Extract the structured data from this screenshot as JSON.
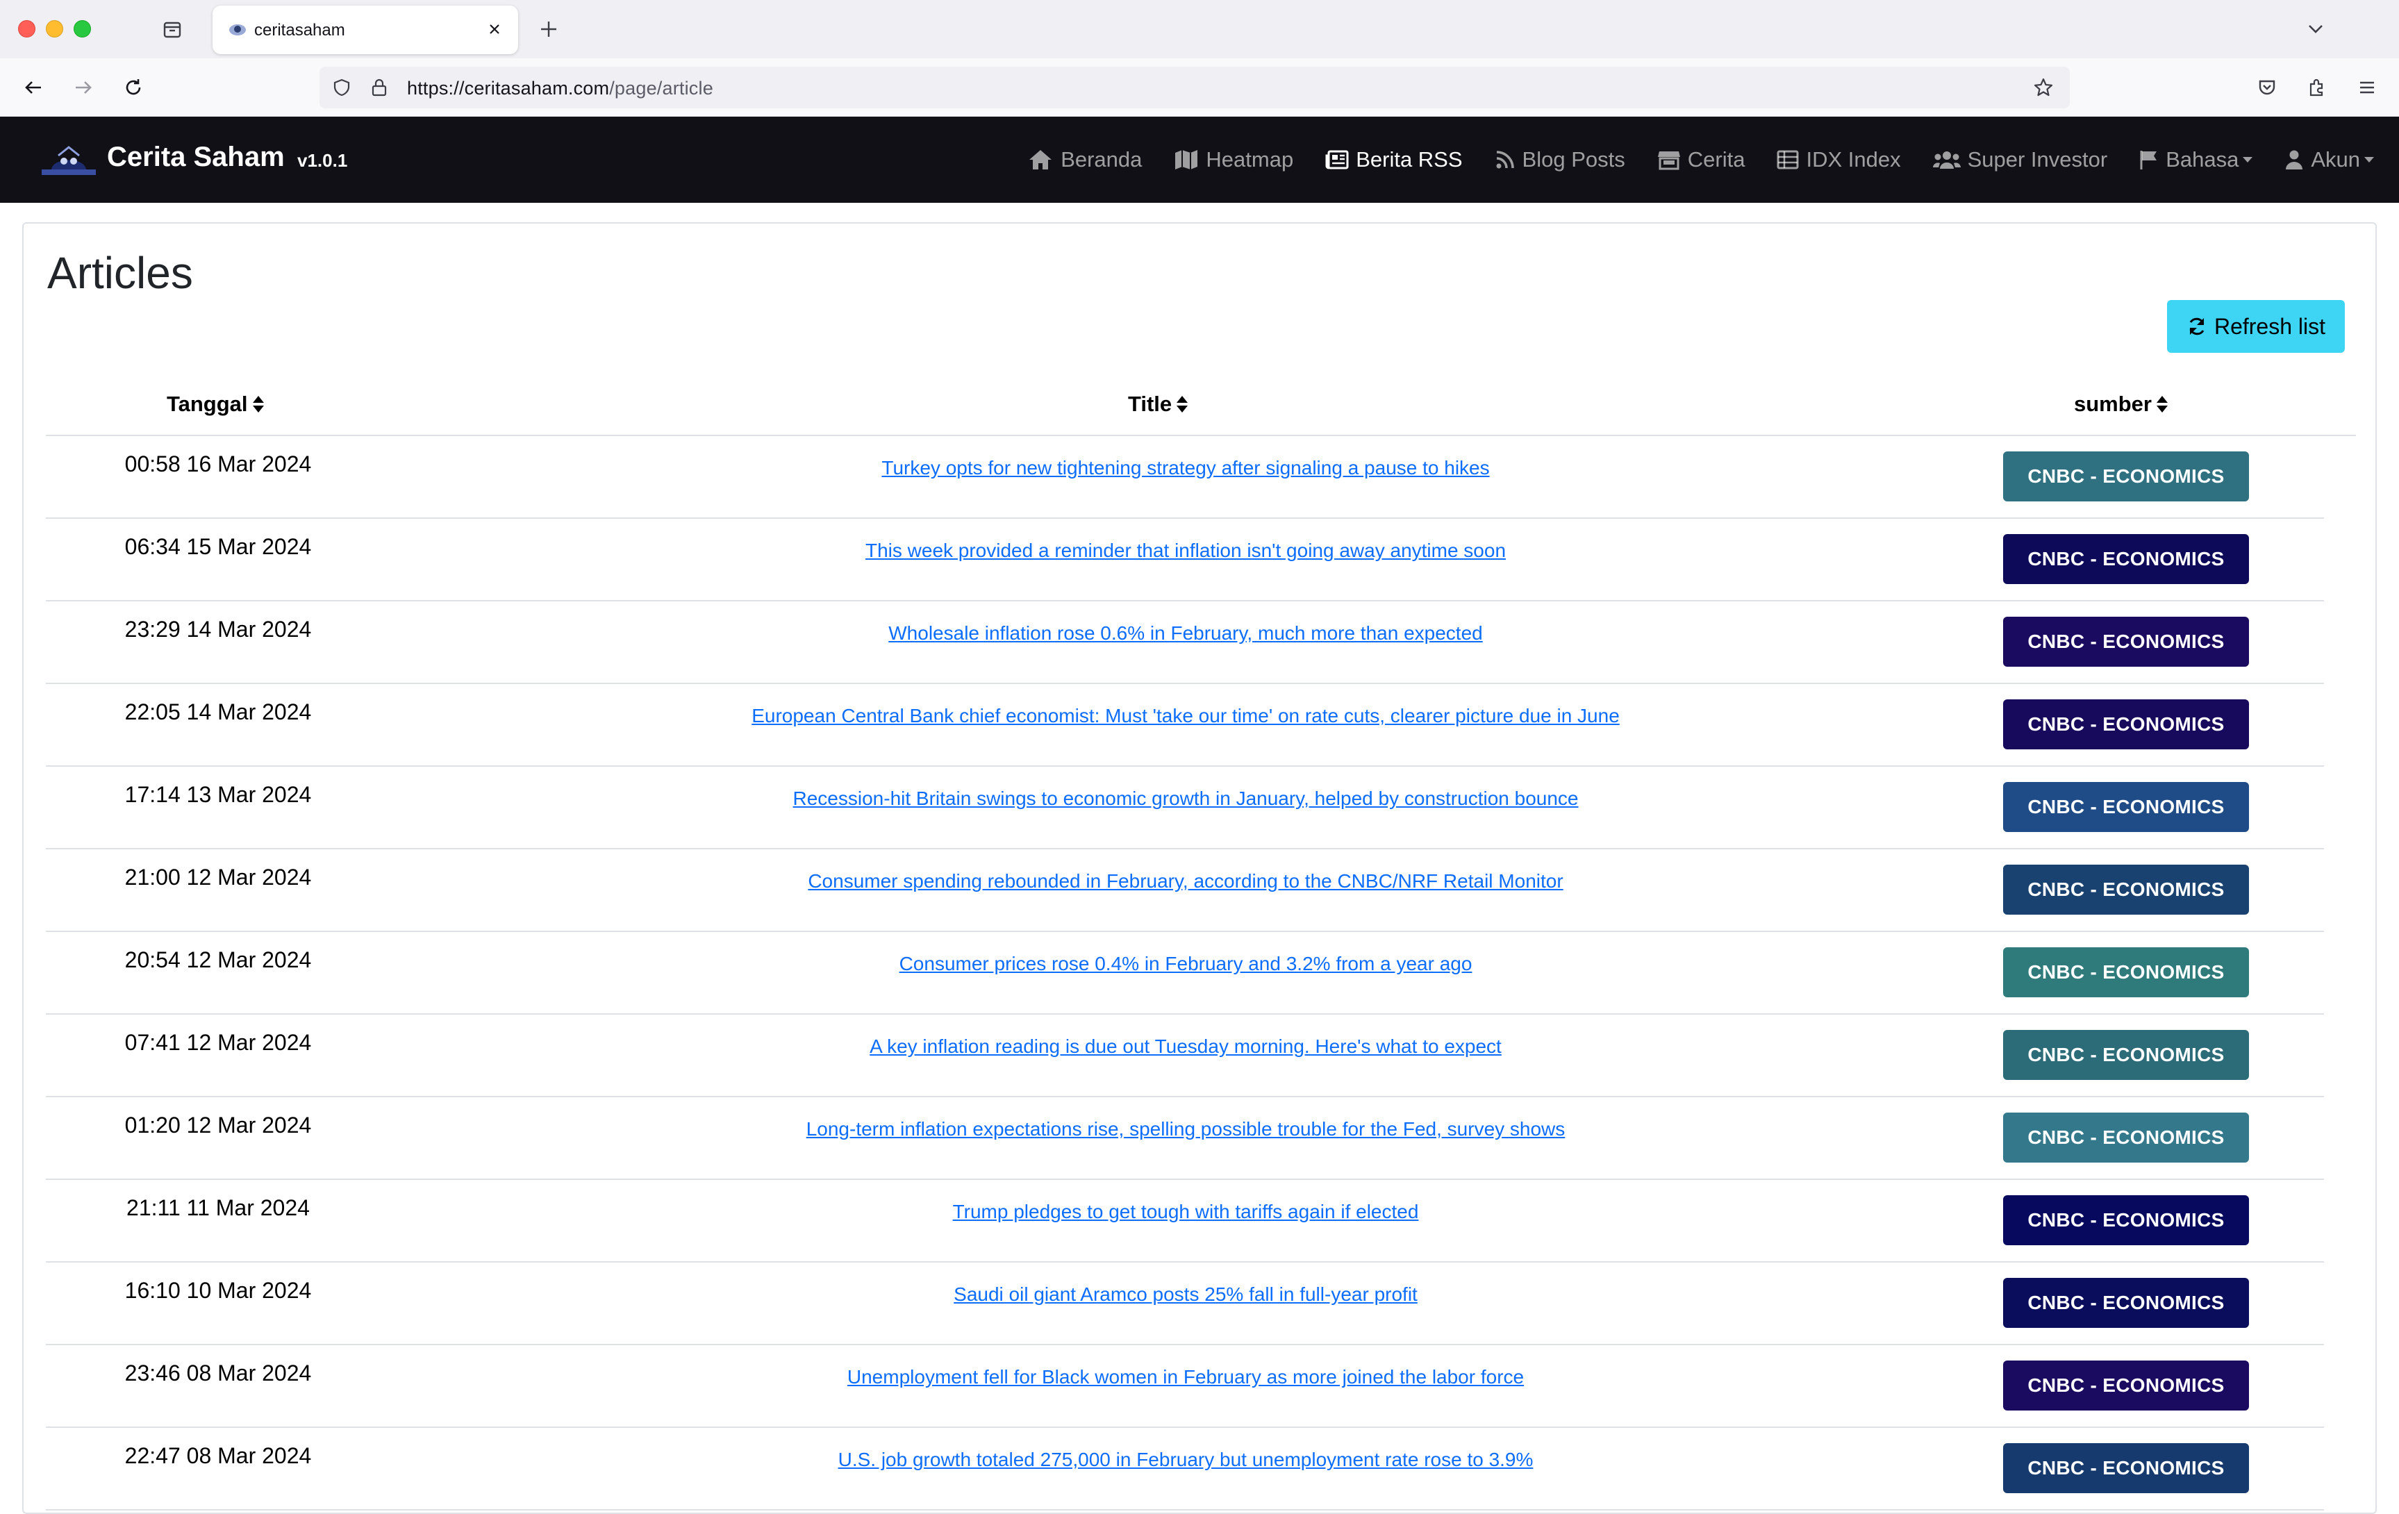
{
  "browser": {
    "tab_title": "ceritasaham",
    "url_host": "https://ceritasaham.com",
    "url_path": "/page/article"
  },
  "app": {
    "brand": "Cerita Saham",
    "version": "v1.0.1",
    "nav": [
      {
        "label": "Beranda",
        "icon": "home-icon"
      },
      {
        "label": "Heatmap",
        "icon": "map-icon"
      },
      {
        "label": "Berita RSS",
        "icon": "newspaper-icon"
      },
      {
        "label": "Blog Posts",
        "icon": "rss-icon"
      },
      {
        "label": "Cerita",
        "icon": "store-icon"
      },
      {
        "label": "IDX Index",
        "icon": "table-icon"
      },
      {
        "label": "Super Investor",
        "icon": "users-icon"
      },
      {
        "label": "Bahasa",
        "icon": "flag-icon"
      },
      {
        "label": "Akun",
        "icon": "user-icon"
      }
    ],
    "active_nav": "Berita RSS"
  },
  "page": {
    "title": "Articles",
    "refresh_label": "Refresh list",
    "columns": [
      "Tanggal",
      "Title",
      "sumber"
    ]
  },
  "articles": [
    {
      "date": "00:58 16 Mar 2024",
      "title": "Turkey opts for new tightening strategy after signaling a pause to hikes",
      "source": "CNBC - ECONOMICS",
      "color": "#2f7180"
    },
    {
      "date": "06:34 15 Mar 2024",
      "title": "This week provided a reminder that inflation isn't going away anytime soon",
      "source": "CNBC - ECONOMICS",
      "color": "#0e0a5a"
    },
    {
      "date": "23:29 14 Mar 2024",
      "title": "Wholesale inflation rose 0.6% in February, much more than expected",
      "source": "CNBC - ECONOMICS",
      "color": "#1a0a60"
    },
    {
      "date": "22:05 14 Mar 2024",
      "title": "European Central Bank chief economist: Must 'take our time' on rate cuts, clearer picture due in June",
      "source": "CNBC - ECONOMICS",
      "color": "#170a5c"
    },
    {
      "date": "17:14 13 Mar 2024",
      "title": "Recession-hit Britain swings to economic growth in January, helped by construction bounce",
      "source": "CNBC - ECONOMICS",
      "color": "#1f4b86"
    },
    {
      "date": "21:00 12 Mar 2024",
      "title": "Consumer spending rebounded in February, according to the CNBC/NRF Retail Monitor",
      "source": "CNBC - ECONOMICS",
      "color": "#1a4270"
    },
    {
      "date": "20:54 12 Mar 2024",
      "title": "Consumer prices rose 0.4% in February and 3.2% from a year ago",
      "source": "CNBC - ECONOMICS",
      "color": "#2f7a7a"
    },
    {
      "date": "07:41 12 Mar 2024",
      "title": "A key inflation reading is due out Tuesday morning. Here's what to expect",
      "source": "CNBC - ECONOMICS",
      "color": "#2c6c78"
    },
    {
      "date": "01:20 12 Mar 2024",
      "title": "Long-term inflation expectations rise, spelling possible trouble for the Fed, survey shows",
      "source": "CNBC - ECONOMICS",
      "color": "#34788c"
    },
    {
      "date": "21:11 11 Mar 2024",
      "title": "Trump pledges to get tough with tariffs again if elected",
      "source": "CNBC - ECONOMICS",
      "color": "#07095e"
    },
    {
      "date": "16:10 10 Mar 2024",
      "title": "Saudi oil giant Aramco posts 25% fall in full-year profit",
      "source": "CNBC - ECONOMICS",
      "color": "#0a0d5c"
    },
    {
      "date": "23:46 08 Mar 2024",
      "title": "Unemployment fell for Black women in February as more joined the labor force",
      "source": "CNBC - ECONOMICS",
      "color": "#1a0a60"
    },
    {
      "date": "22:47 08 Mar 2024",
      "title": "U.S. job growth totaled 275,000 in February but unemployment rate rose to 3.9%",
      "source": "CNBC - ECONOMICS",
      "color": "#173a6e"
    }
  ]
}
